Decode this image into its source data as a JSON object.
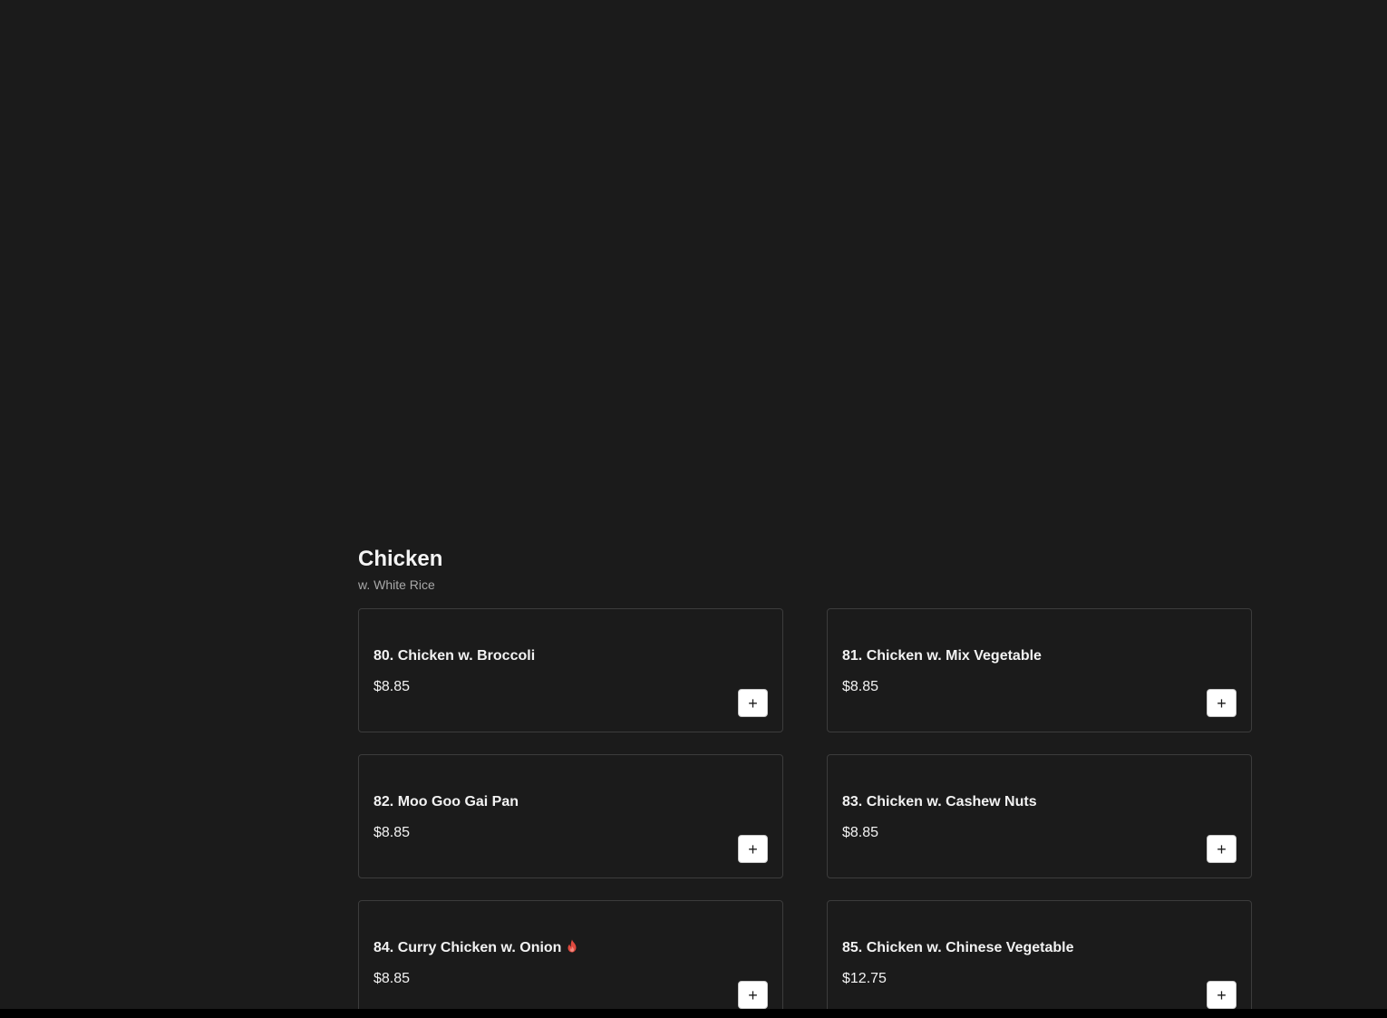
{
  "section": {
    "title": "Chicken",
    "subtitle": "w. White Rice"
  },
  "items": [
    {
      "name": "80. Chicken w. Broccoli",
      "price": "$8.85",
      "spicy": false,
      "add_label": "+"
    },
    {
      "name": "81. Chicken w. Mix Vegetable",
      "price": "$8.85",
      "spicy": false,
      "add_label": "+"
    },
    {
      "name": "82. Moo Goo Gai Pan",
      "price": "$8.85",
      "spicy": false,
      "add_label": "+"
    },
    {
      "name": "83. Chicken w. Cashew Nuts",
      "price": "$8.85",
      "spicy": false,
      "add_label": "+"
    },
    {
      "name": "84. Curry Chicken w. Onion",
      "price": "$8.85",
      "spicy": true,
      "add_label": "+"
    },
    {
      "name": "85. Chicken w. Chinese Vegetable",
      "price": "$12.75",
      "spicy": false,
      "add_label": "+"
    }
  ],
  "icons": {
    "spicy": "flame-icon"
  },
  "colors": {
    "background": "#1b1b1b",
    "card_border": "#3c3c3c",
    "text": "#f2f2f2",
    "subtitle": "#a8a8a8",
    "button_bg": "#ffffff",
    "spicy": "#e04a3f"
  }
}
